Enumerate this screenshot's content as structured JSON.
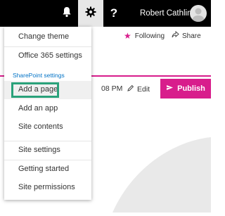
{
  "suite_bar": {
    "user_name": "Robert Cathlina",
    "help_label": "?"
  },
  "page": {
    "follow_label": "Following",
    "share_label": "Share",
    "time_fragment": "08 PM",
    "edit_label": "Edit",
    "publish_label": "Publish"
  },
  "settings_menu": {
    "section_header": "SharePoint settings",
    "items": [
      {
        "label": "Change theme"
      },
      {
        "label": "Office 365 settings"
      },
      {
        "label": "Add a page"
      },
      {
        "label": "Add an app"
      },
      {
        "label": "Site contents"
      },
      {
        "label": "Site settings"
      },
      {
        "label": "Getting started"
      },
      {
        "label": "Site permissions"
      }
    ]
  },
  "colors": {
    "suite_bar": "#000000",
    "accent": "#d81d8c",
    "link": "#0072c6",
    "highlight": "#2aa17a"
  }
}
